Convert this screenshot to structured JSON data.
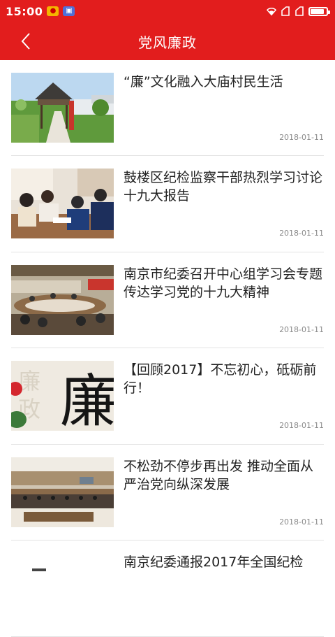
{
  "status_bar": {
    "time": "15:00",
    "notification_icons": [
      "app-notification-icon",
      "screenshot-notification-icon"
    ],
    "right_icons": [
      "wifi-icon",
      "signal-icon",
      "signal-icon",
      "battery-icon"
    ],
    "battery_level": 0.85
  },
  "header": {
    "title": "党风廉政",
    "back_icon": "chevron-left-icon",
    "background": "#e21d1d"
  },
  "articles": [
    {
      "title": "“廉”文化融入大庙村民生活",
      "date": "2018-01-11"
    },
    {
      "title": "鼓楼区纪检监察干部热烈学习讨论十九大报告",
      "date": "2018-01-11"
    },
    {
      "title": "南京市纪委召开中心组学习会专题传达学习党的十九大精神",
      "date": "2018-01-11"
    },
    {
      "title": "【回顾2017】不忘初心，砥砺前行！",
      "date": "2018-01-11"
    },
    {
      "title": "不松劲不停步再出发 推动全面从严治党向纵深发展",
      "date": "2018-01-11"
    },
    {
      "title": "南京纪委通报2017年全国纪检",
      "date": ""
    }
  ],
  "thumb_text": {
    "calligraphy_large": "廉",
    "calligraphy_faint_1": "廉",
    "calligraphy_faint_2": "政"
  }
}
